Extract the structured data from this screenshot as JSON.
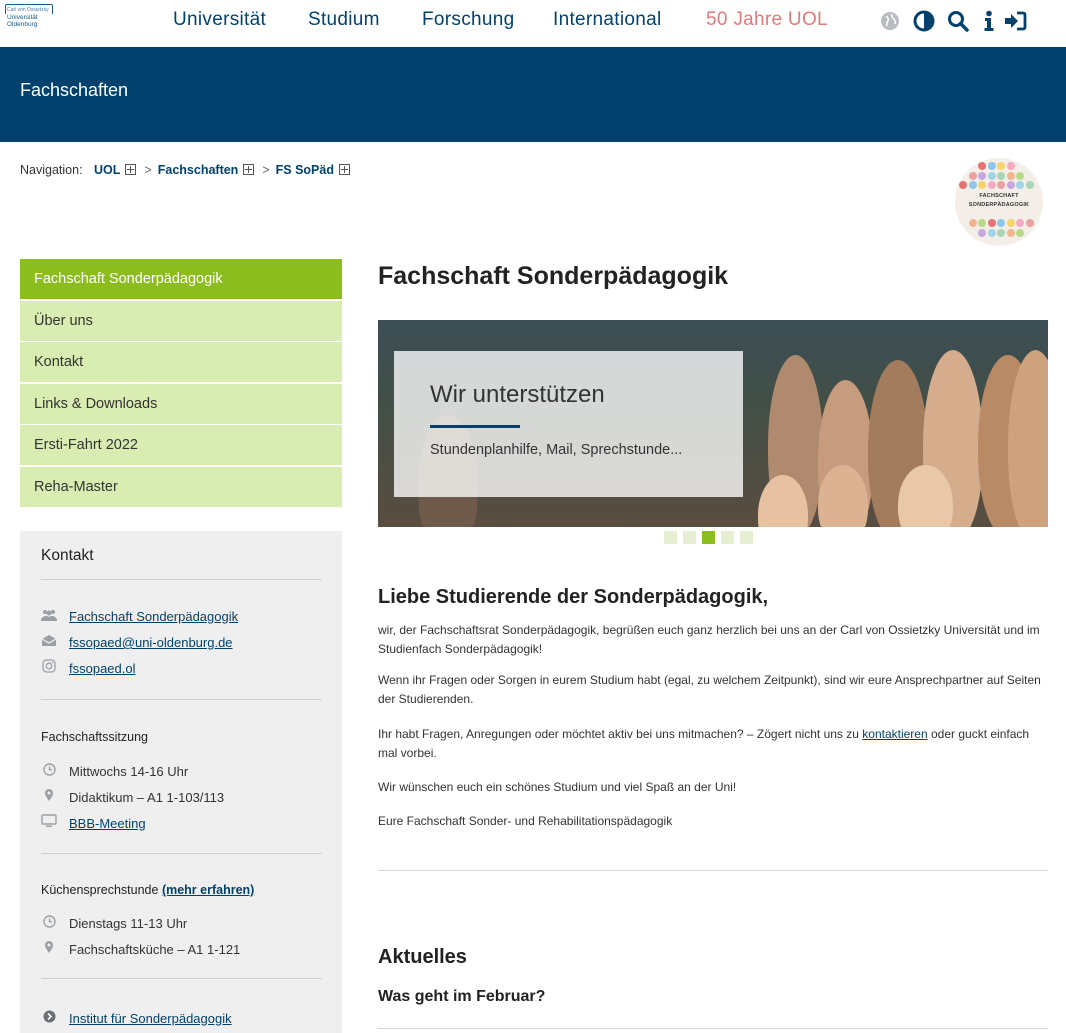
{
  "logo": {
    "line1": "Carl von Ossietzky",
    "line2": "Universität",
    "line3": "Oldenburg"
  },
  "nav": {
    "items": [
      "Universität",
      "Studium",
      "Forschung",
      "International",
      "50 Jahre UOL"
    ],
    "special_color": "#e07a7a",
    "tools": [
      "globe-icon",
      "contrast-icon",
      "search-icon",
      "info-icon",
      "login-icon"
    ]
  },
  "band": {
    "title": "Fachschaften"
  },
  "breadcrumb": {
    "label": "Navigation:",
    "items": [
      "UOL",
      "Fachschaften",
      "FS SoPäd"
    ]
  },
  "fs_logo": {
    "line1": "FACHSCHAFT",
    "line2": "SONDERPÄDAGOGIK"
  },
  "sidebar": {
    "items": [
      "Fachschaft Sonderpädagogik",
      "Über uns",
      "Kontakt",
      "Links & Downloads",
      "Ersti-Fahrt 2022",
      "Reha-Master"
    ],
    "active_color": "#8cbd1e",
    "item_color": "#d9ecb2"
  },
  "kontakt": {
    "title": "Kontakt",
    "links": [
      {
        "icon": "group-icon",
        "text": "Fachschaft Sonderpädagogik"
      },
      {
        "icon": "mail-icon",
        "text": "fssopaed@uni-oldenburg.de"
      },
      {
        "icon": "instagram-icon",
        "text": "fssopaed.ol"
      }
    ],
    "sitzung": {
      "heading": "Fachschaftssitzung",
      "time": "Mittwochs 14-16 Uhr",
      "place": "Didaktikum – A1 1-103/113",
      "meeting": "BBB-Meeting"
    },
    "kueche": {
      "heading": "Küchensprechstunde",
      "more": "(mehr erfahren)",
      "time": "Dienstags 11-13 Uhr",
      "place": "Fachschaftsküche – A1 1-121"
    },
    "institut": "Institut für Sonderpädagogik"
  },
  "main": {
    "title": "Fachschaft Sonderpädagogik",
    "slide": {
      "title": "Wir unterstützen",
      "subtitle": "Stundenplanhilfe, Mail, Sprechstunde...",
      "count": 5,
      "active": 3
    },
    "greeting": "Liebe Studierende der Sonderpädagogik,",
    "p1": "wir, der Fachschaftsrat Sonderpädagogik, begrüßen euch ganz herzlich bei uns an der Carl von Ossietzky Universität und im Studienfach Sonderpädagogik!",
    "p2": "Wenn ihr Fragen oder Sorgen in eurem Studium habt (egal, zu welchem Zeitpunkt), sind wir eure Ansprechpartner auf Seiten der Studierenden.",
    "p3_before": "Ihr habt Fragen, Anregungen oder möchtet aktiv bei uns mitmachen? – Zögert nicht uns zu ",
    "p3_link": "kontaktieren",
    "p3_after": " oder guckt einfach mal vorbei.",
    "p4": "Wir wünschen euch ein schönes Studium und viel Spaß an der Uni!",
    "p5": "Eure Fachschaft Sonder- und Rehabilitationspädagogik",
    "news_title": "Aktuelles",
    "news_sub": "Was geht im Februar?"
  }
}
